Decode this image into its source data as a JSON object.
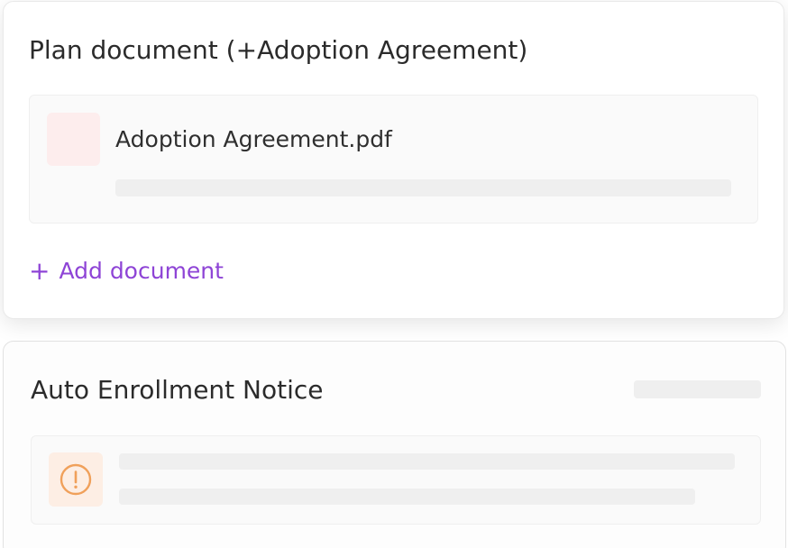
{
  "plan_document": {
    "title": "Plan document (+Adoption Agreement)",
    "file": {
      "name": "Adoption Agreement.pdf",
      "icon": "file-thumbnail"
    },
    "add_label": "Add document",
    "add_icon": "plus-icon"
  },
  "auto_enrollment": {
    "title": "Auto Enrollment Notice",
    "item": {
      "icon": "warning-icon"
    }
  },
  "colors": {
    "accent": "#8e44d6",
    "warning": "#f0a05a",
    "file_thumb_bg": "#fdeded",
    "warning_bg": "#fdeee4"
  }
}
